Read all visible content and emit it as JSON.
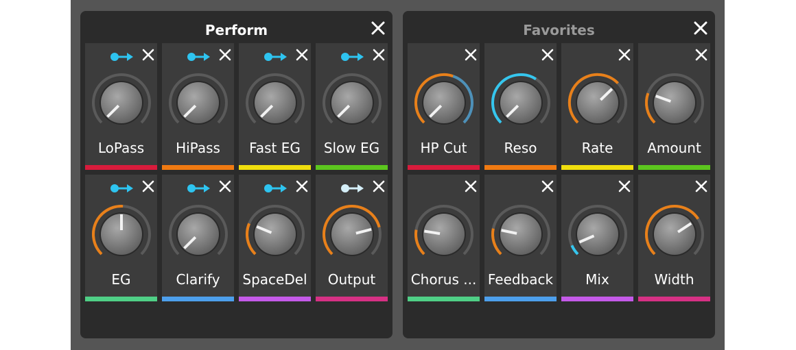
{
  "panels": [
    {
      "title": "Perform",
      "title_color": "#ffffff",
      "items": [
        {
          "label": "LoPass",
          "color": "#d81b3c",
          "has_arrow": true,
          "arrow_color": "#2ec4f0",
          "value": 0.0,
          "ring_color": "#8a8a8a"
        },
        {
          "label": "HiPass",
          "color": "#f07a12",
          "has_arrow": true,
          "arrow_color": "#2ec4f0",
          "value": 0.0,
          "ring_color": "#8a8a8a"
        },
        {
          "label": "Fast EG",
          "color": "#f0de0e",
          "has_arrow": true,
          "arrow_color": "#2ec4f0",
          "value": 0.0,
          "ring_color": "#8a8a8a"
        },
        {
          "label": "Slow EG",
          "color": "#5cc61e",
          "has_arrow": true,
          "arrow_color": "#2ec4f0",
          "value": 0.0,
          "ring_color": "#8a8a8a"
        },
        {
          "label": "EG",
          "color": "#4fcf86",
          "has_arrow": true,
          "arrow_color": "#2ec4f0",
          "value": 0.5,
          "ring_color": "#e8801a"
        },
        {
          "label": "Clarify",
          "color": "#4d9fec",
          "has_arrow": true,
          "arrow_color": "#2ec4f0",
          "value": 0.0,
          "ring_color": "#8a8a8a"
        },
        {
          "label": "SpaceDel",
          "color": "#c45ae8",
          "has_arrow": true,
          "arrow_color": "#2ec4f0",
          "value": 0.25,
          "ring_color": "#e8801a"
        },
        {
          "label": "Output",
          "color": "#d63184",
          "has_arrow": true,
          "arrow_color": "#d4eef8",
          "value": 0.78,
          "ring_color": "#e8801a"
        }
      ]
    },
    {
      "title": "Favorites",
      "title_color": "#9a9a9a",
      "items": [
        {
          "label": "HP Cut",
          "color": "#d81b3c",
          "has_arrow": false,
          "value": 0.0,
          "ring_color": "#e8801a",
          "secondary_value": 0.57,
          "secondary_color": "#4d90b8"
        },
        {
          "label": "Reso",
          "color": "#f07a12",
          "has_arrow": false,
          "value": 0.0,
          "ring_color": "#35c6ee",
          "ring_from": 0.0,
          "ring_to": 0.62
        },
        {
          "label": "Rate",
          "color": "#f0de0e",
          "has_arrow": false,
          "value": 0.67,
          "ring_color": "#e8801a"
        },
        {
          "label": "Amount",
          "color": "#5cc61e",
          "has_arrow": false,
          "value": 0.24,
          "ring_color": "#e8801a"
        },
        {
          "label": "Chorus ...",
          "color": "#4fcf86",
          "has_arrow": false,
          "value": 0.2,
          "ring_color": "#e8801a"
        },
        {
          "label": "Feedback",
          "color": "#4d9fec",
          "has_arrow": false,
          "value": 0.21,
          "ring_color": "#e8801a"
        },
        {
          "label": "Mix",
          "color": "#c45ae8",
          "has_arrow": false,
          "value": 0.08,
          "ring_color": "#35c6ee"
        },
        {
          "label": "Width",
          "color": "#d63184",
          "has_arrow": false,
          "value": 0.71,
          "ring_color": "#e8801a"
        }
      ]
    }
  ],
  "icons": {
    "close": "close-icon",
    "arrow": "arrow-right-icon"
  }
}
